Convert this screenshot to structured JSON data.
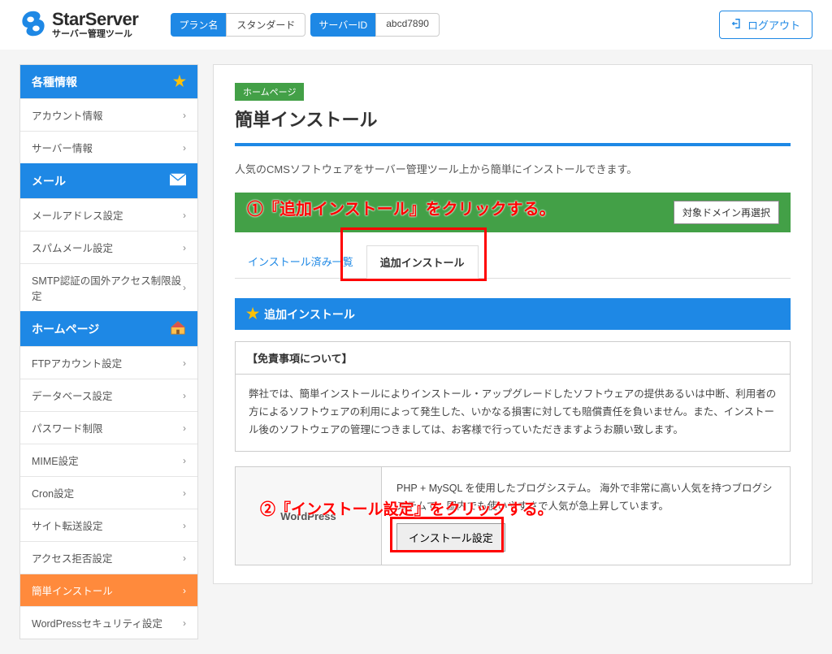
{
  "header": {
    "logo_title": "StarServer",
    "logo_sub": "サーバー管理ツール",
    "plan_label": "プラン名",
    "plan_value": "スタンダード",
    "server_id_label": "サーバーID",
    "server_id_value": "abcd7890",
    "logout": "ログアウト"
  },
  "sidebar": {
    "sections": [
      {
        "title": "各種情報",
        "icon": "star",
        "items": [
          "アカウント情報",
          "サーバー情報"
        ]
      },
      {
        "title": "メール",
        "icon": "envelope",
        "items": [
          "メールアドレス設定",
          "スパムメール設定",
          "SMTP認証の国外アクセス制限設定"
        ]
      },
      {
        "title": "ホームページ",
        "icon": "house",
        "items": [
          "FTPアカウント設定",
          "データベース設定",
          "パスワード制限",
          "MIME設定",
          "Cron設定",
          "サイト転送設定",
          "アクセス拒否設定",
          "簡単インストール",
          "WordPressセキュリティ設定"
        ],
        "active_index": 7
      }
    ]
  },
  "main": {
    "breadcrumb": "ホームページ",
    "title": "簡単インストール",
    "intro": "人気のCMSソフトウェアをサーバー管理ツール上から簡単にインストールできます。",
    "reselect": "対象ドメイン再選択",
    "tabs": [
      "インストール済み一覧",
      "追加インストール"
    ],
    "active_tab": 1,
    "section_bar": "追加インストール",
    "disclaimer_head": "【免責事項について】",
    "disclaimer_body": "弊社では、簡単インストールによりインストール・アップグレードしたソフトウェアの提供あるいは中断、利用者の方によるソフトウェアの利用によって発生した、いかなる損害に対しても賠償責任を負いません。また、インストール後のソフトウェアの管理につきましては、お客様で行っていただきますようお願い致します。",
    "product_name": "WordPress",
    "product_desc": "PHP + MySQL を使用したブログシステム。 海外で非常に高い人気を持つブログシステムで、国内でも使いやすさで人気が急上昇しています。",
    "install_btn": "インストール設定"
  },
  "annotations": {
    "a1": "①『追加インストール』をクリックする。",
    "a2": "②『インストール設定』をクリックする。"
  }
}
